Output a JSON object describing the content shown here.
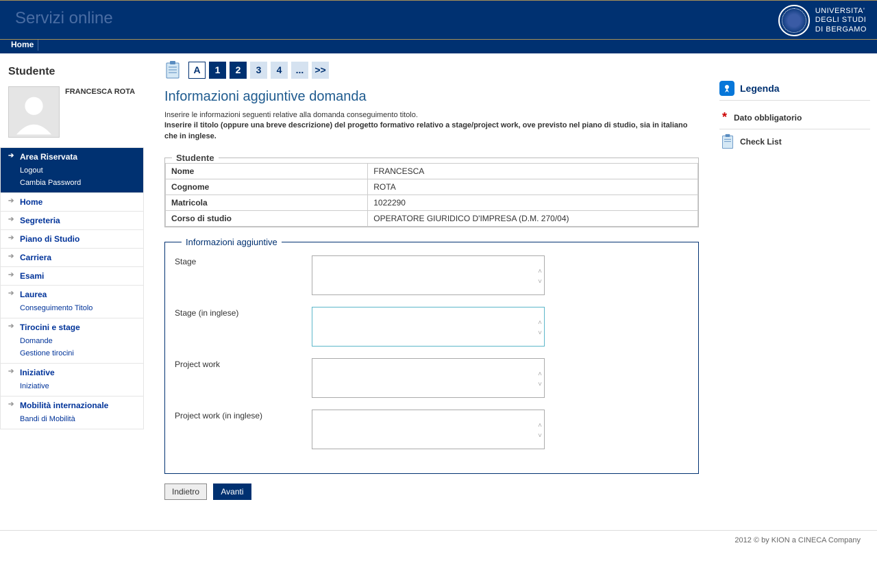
{
  "header": {
    "site_title": "Servizi online",
    "uni_line1": "UNIVERSITA'",
    "uni_line2": "DEGLI STUDI",
    "uni_line3": "DI BERGAMO"
  },
  "topbar": {
    "home": "Home"
  },
  "sidebar": {
    "title": "Studente",
    "user_name": "FRANCESCA ROTA",
    "sections": [
      {
        "label": "Area Riservata",
        "active": true,
        "subs": [
          "Logout",
          "Cambia Password"
        ]
      },
      {
        "label": "Home",
        "subs": []
      },
      {
        "label": "Segreteria",
        "subs": []
      },
      {
        "label": "Piano di Studio",
        "subs": []
      },
      {
        "label": "Carriera",
        "subs": []
      },
      {
        "label": "Esami",
        "subs": []
      },
      {
        "label": "Laurea",
        "subs": [
          "Conseguimento Titolo"
        ]
      },
      {
        "label": "Tirocini e stage",
        "subs": [
          "Domande",
          "Gestione tirocini"
        ]
      },
      {
        "label": "Iniziative",
        "subs": [
          "Iniziative"
        ]
      },
      {
        "label": "Mobilità internazionale",
        "subs": [
          "Bandi di Mobilità"
        ]
      }
    ]
  },
  "steps": [
    "A",
    "1",
    "2",
    "3",
    "4",
    "...",
    ">>"
  ],
  "page": {
    "title": "Informazioni aggiuntive domanda",
    "instr1": "Inserire le informazioni seguenti relative alla domanda conseguimento titolo.",
    "instr2": "Inserire il titolo (oppure una breve descrizione) del progetto formativo relativo a stage/project work, ove previsto nel piano di studio, sia in italiano che in inglese."
  },
  "student": {
    "legend": "Studente",
    "nome_label": "Nome",
    "nome": "FRANCESCA",
    "cognome_label": "Cognome",
    "cognome": "ROTA",
    "matricola_label": "Matricola",
    "matricola": "1022290",
    "corso_label": "Corso di studio",
    "corso": "OPERATORE GIURIDICO D'IMPRESA (D.M. 270/04)"
  },
  "info": {
    "legend": "Informazioni aggiuntive",
    "fields": [
      {
        "label": "Stage",
        "value": ""
      },
      {
        "label": "Stage (in inglese)",
        "value": ""
      },
      {
        "label": "Project work",
        "value": ""
      },
      {
        "label": "Project work (in inglese)",
        "value": ""
      }
    ]
  },
  "buttons": {
    "back": "Indietro",
    "next": "Avanti"
  },
  "legend_box": {
    "title": "Legenda",
    "mandatory": "Dato obbligatorio",
    "checklist": "Check List"
  },
  "footer": "2012 © by KION a CINECA Company"
}
